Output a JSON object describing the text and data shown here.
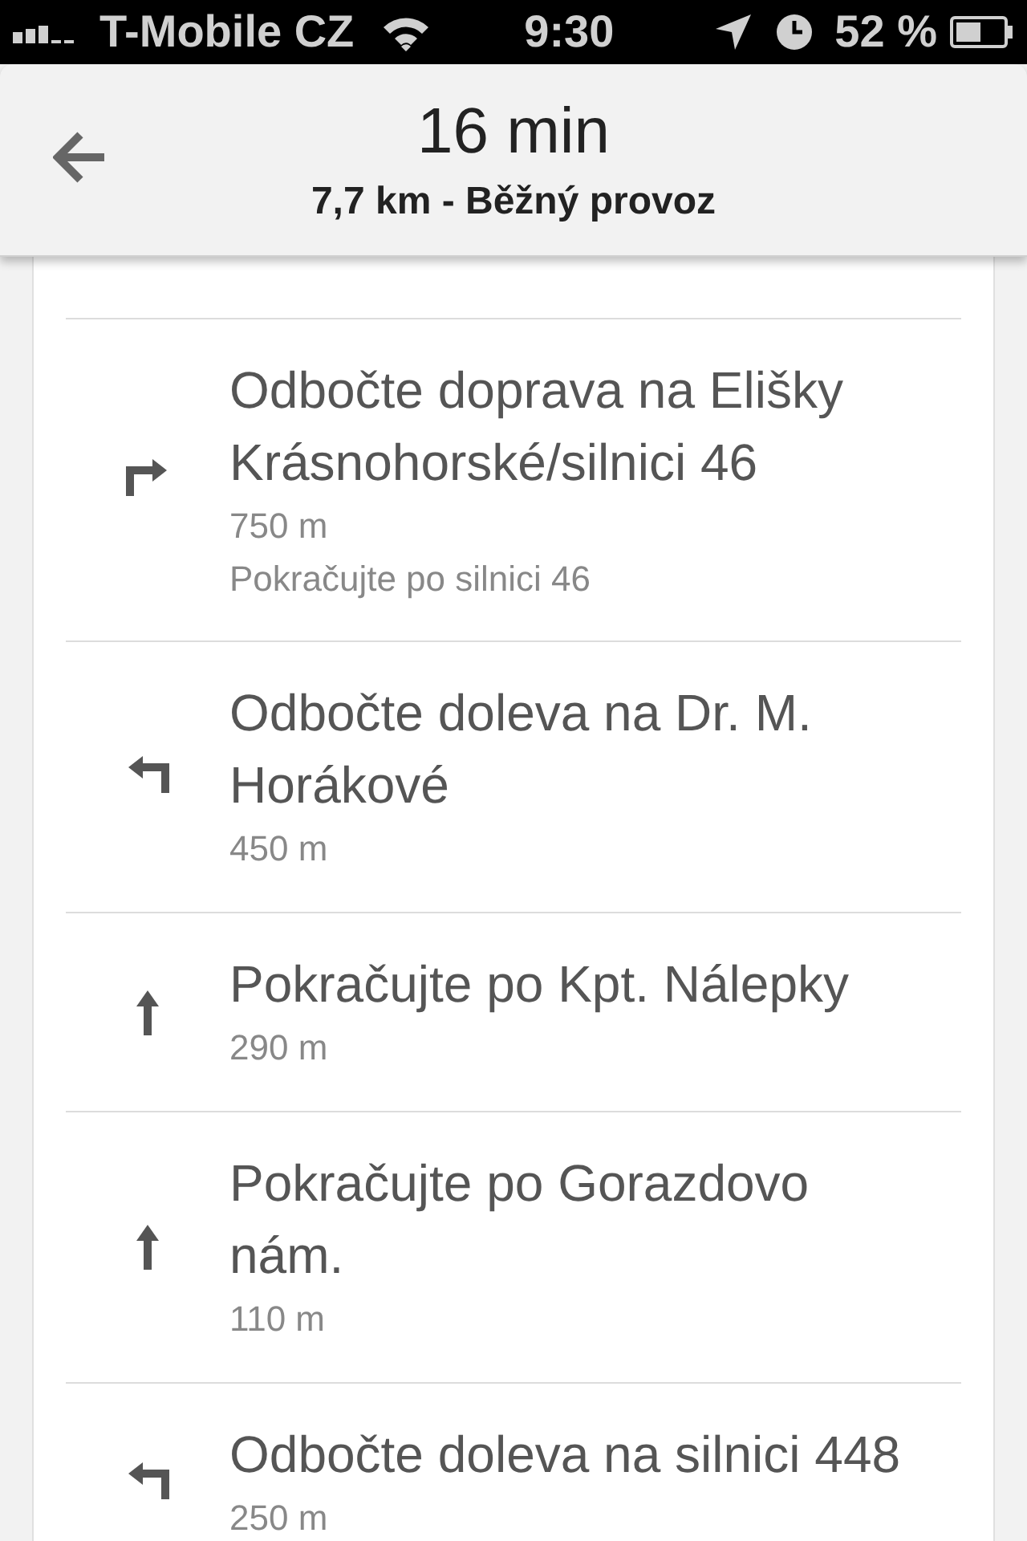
{
  "status_bar": {
    "carrier": "T-Mobile CZ",
    "time": "9:30",
    "battery": "52 %"
  },
  "header": {
    "title": "16 min",
    "subtitle": "7,7 km - Běžný provoz"
  },
  "steps": [
    {
      "kind": "right",
      "instruction": "Odbočte doprava na Elišky Krásnohorské/silnici 46",
      "distance": "750 m",
      "note": "Pokračujte po silnici 46"
    },
    {
      "kind": "left",
      "instruction": "Odbočte doleva na Dr. M. Horákové",
      "distance": "450 m"
    },
    {
      "kind": "straight",
      "instruction": "Pokračujte po Kpt. Nálepky",
      "distance": "290 m"
    },
    {
      "kind": "straight",
      "instruction": "Pokračujte po Gorazdovo nám.",
      "distance": "110 m"
    },
    {
      "kind": "left",
      "instruction": "Odbočte doleva na silnici 448",
      "distance": "250 m"
    }
  ]
}
